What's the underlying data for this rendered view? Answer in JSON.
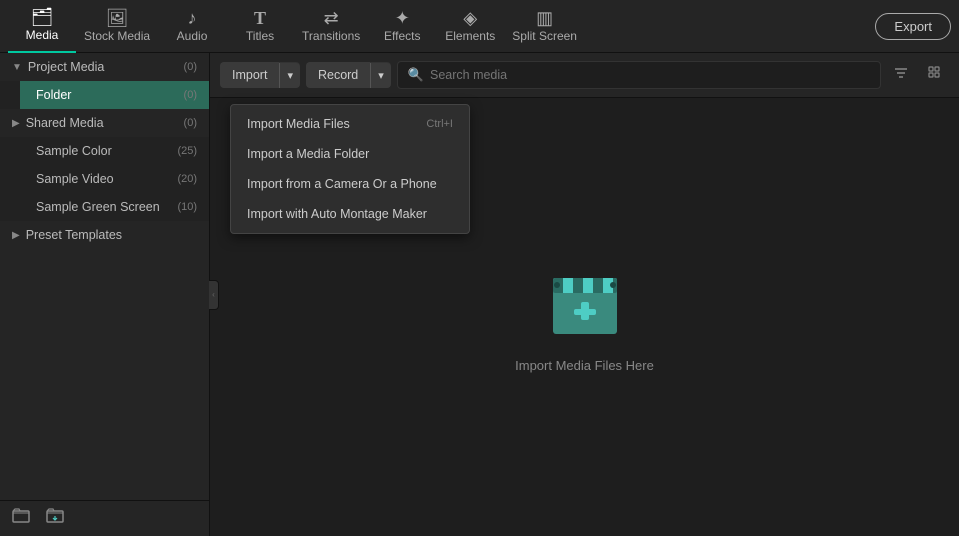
{
  "nav": {
    "items": [
      {
        "id": "media",
        "label": "Media",
        "icon": "🗂",
        "active": true
      },
      {
        "id": "stock-media",
        "label": "Stock Media",
        "icon": "🖼"
      },
      {
        "id": "audio",
        "label": "Audio",
        "icon": "♪"
      },
      {
        "id": "titles",
        "label": "Titles",
        "icon": "T"
      },
      {
        "id": "transitions",
        "label": "Transitions",
        "icon": "⇄"
      },
      {
        "id": "effects",
        "label": "Effects",
        "icon": "✦"
      },
      {
        "id": "elements",
        "label": "Elements",
        "icon": "◈"
      },
      {
        "id": "split-screen",
        "label": "Split Screen",
        "icon": "▥"
      }
    ],
    "export_label": "Export"
  },
  "sidebar": {
    "sections": [
      {
        "id": "project-media",
        "label": "Project Media",
        "count": "(0)",
        "expanded": true,
        "children": [
          {
            "id": "folder",
            "label": "Folder",
            "count": "(0)",
            "selected": true
          }
        ]
      },
      {
        "id": "shared-media",
        "label": "Shared Media",
        "count": "(0)",
        "expanded": true,
        "children": [
          {
            "id": "sample-color",
            "label": "Sample Color",
            "count": "(25)"
          },
          {
            "id": "sample-video",
            "label": "Sample Video",
            "count": "(20)"
          },
          {
            "id": "sample-green-screen",
            "label": "Sample Green Screen",
            "count": "(10)"
          }
        ]
      },
      {
        "id": "preset-templates",
        "label": "Preset Templates",
        "count": "",
        "expanded": false,
        "children": []
      }
    ],
    "footer_buttons": [
      {
        "id": "new-folder",
        "icon": "🗀",
        "label": "New Folder"
      },
      {
        "id": "import-folder",
        "icon": "🗁",
        "label": "Import Folder"
      }
    ]
  },
  "toolbar": {
    "import_label": "Import",
    "record_label": "Record",
    "search_placeholder": "Search media",
    "dropdown_open": true,
    "dropdown_items": [
      {
        "id": "import-files",
        "label": "Import Media Files",
        "shortcut": "Ctrl+I"
      },
      {
        "id": "import-folder",
        "label": "Import a Media Folder",
        "shortcut": ""
      },
      {
        "id": "import-camera",
        "label": "Import from a Camera Or a Phone",
        "shortcut": ""
      },
      {
        "id": "import-montage",
        "label": "Import with Auto Montage Maker",
        "shortcut": ""
      }
    ]
  },
  "main": {
    "empty_hint": "Import Media Files Here",
    "clapperboard_color": "#4ecdc4"
  }
}
